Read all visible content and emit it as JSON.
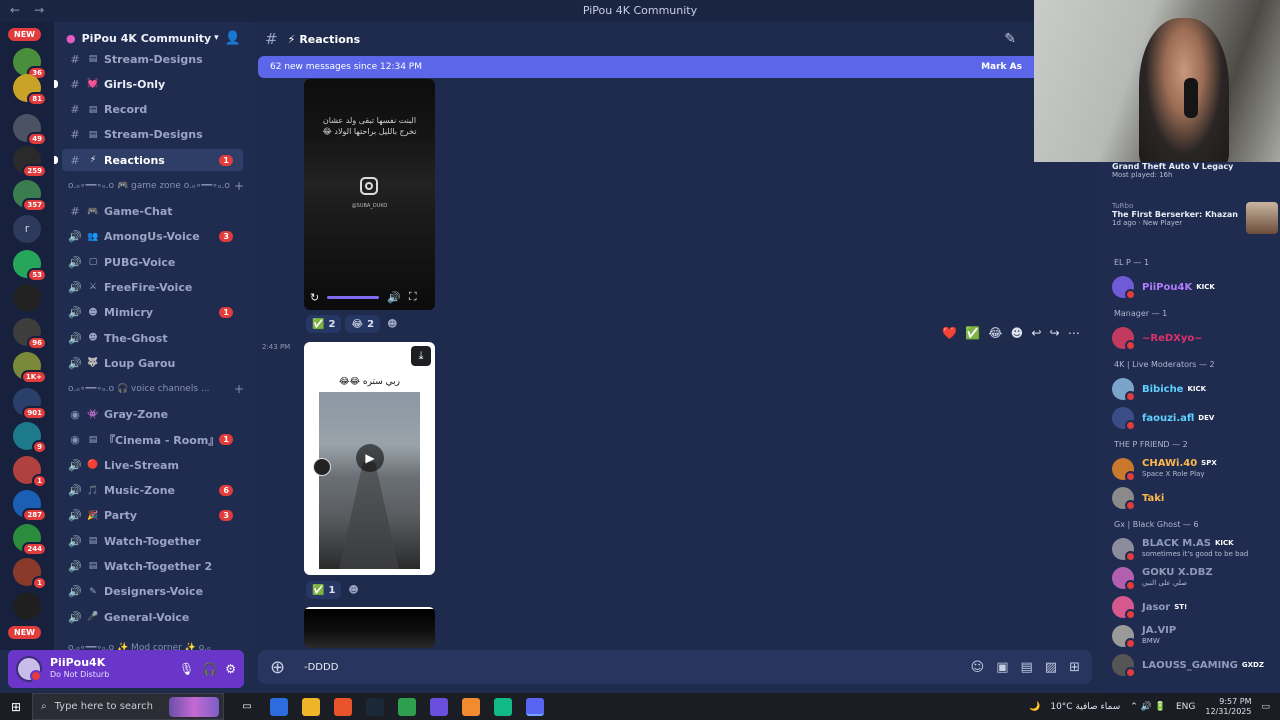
{
  "window": {
    "title": "PiPou 4K Community",
    "back": "←",
    "forward": "→"
  },
  "rail": {
    "new_top": "NEW",
    "new_bottom": "NEW",
    "servers": [
      {
        "badge": "36",
        "color": "#4a8d3a"
      },
      {
        "badge": "81",
        "color": "#c9a227"
      },
      {
        "badge": "49",
        "color": "#4b5263"
      },
      {
        "badge": "259",
        "color": "#2a2a2a"
      },
      {
        "badge": "357",
        "color": "#3b7d4f"
      },
      {
        "badge": "",
        "letter": "r",
        "color": "#2e3a5c"
      },
      {
        "badge": "53",
        "color": "#26a65b"
      },
      {
        "badge": "",
        "color": "#222222"
      },
      {
        "badge": "96",
        "color": "#3d3d3d"
      },
      {
        "badge": "1K+",
        "color": "#7a8a3a"
      },
      {
        "badge": "901",
        "color": "#2a3f6a"
      },
      {
        "badge": "9",
        "color": "#1c7a8a"
      },
      {
        "badge": "1",
        "color": "#b0413e"
      },
      {
        "badge": "287",
        "color": "#1a5fb4"
      },
      {
        "badge": "244",
        "color": "#2b8c3e"
      },
      {
        "badge": "1",
        "color": "#8a3a2a"
      },
      {
        "badge": "",
        "color": "#1f1f1f"
      }
    ]
  },
  "sidebar": {
    "guild_name": "PiPou 4K Community",
    "channels": [
      {
        "kind": "text",
        "icon": "#",
        "emoji": "▤",
        "label": "Stream-Designs",
        "state": "muted"
      },
      {
        "kind": "text",
        "icon": "#",
        "emoji": "💓",
        "label": "Girls-Only",
        "state": "bright",
        "unread": true
      },
      {
        "kind": "text",
        "icon": "#",
        "emoji": "▤",
        "label": "Record",
        "state": "muted"
      },
      {
        "kind": "text",
        "icon": "#",
        "emoji": "▤",
        "label": "Stream-Designs",
        "state": "muted"
      },
      {
        "kind": "text",
        "icon": "#",
        "emoji": "⚡",
        "label": "Reactions",
        "state": "selected",
        "count": "1",
        "unread": true
      },
      {
        "kind": "category",
        "label": "o.ₒ∘━━∘ₒ.o 🎮 game zone o.ₒ∘━━∘ₒ.o"
      },
      {
        "kind": "text",
        "icon": "#",
        "emoji": "🎮",
        "label": "Game-Chat",
        "state": "muted"
      },
      {
        "kind": "voice",
        "icon": "🔊",
        "emoji": "👥",
        "label": "AmongUs-Voice",
        "state": "muted",
        "count": "3"
      },
      {
        "kind": "voice",
        "icon": "🔊",
        "emoji": "▢",
        "label": "PUBG-Voice",
        "state": "muted"
      },
      {
        "kind": "voice",
        "icon": "🔊",
        "emoji": "⚔",
        "label": "FreeFire-Voice",
        "state": "muted"
      },
      {
        "kind": "voice",
        "icon": "🔊",
        "emoji": "☻",
        "label": "Mimicry",
        "state": "muted",
        "count": "1"
      },
      {
        "kind": "voice",
        "icon": "🔊",
        "emoji": "☻",
        "label": "The-Ghost",
        "state": "muted"
      },
      {
        "kind": "voice",
        "icon": "🔊",
        "emoji": "🐺",
        "label": "Loup Garou",
        "state": "muted"
      },
      {
        "kind": "category",
        "label": "o.ₒ∘━━∘ₒ.o 🎧 voice channels ..."
      },
      {
        "kind": "stage",
        "icon": "◉",
        "emoji": "👾",
        "label": "Gray-Zone",
        "state": "muted"
      },
      {
        "kind": "stage",
        "icon": "◉",
        "emoji": "▤",
        "label": "『Cinema - Room』",
        "state": "muted",
        "count": "1"
      },
      {
        "kind": "voice",
        "icon": "🔊",
        "emoji": "🔴",
        "label": "Live-Stream",
        "state": "muted"
      },
      {
        "kind": "voice",
        "icon": "🔊",
        "emoji": "🎵",
        "label": "Music-Zone",
        "state": "muted",
        "count": "6"
      },
      {
        "kind": "voice",
        "icon": "🔊",
        "emoji": "🎉",
        "label": "Party",
        "state": "muted",
        "count": "3"
      },
      {
        "kind": "voice",
        "icon": "🔊",
        "emoji": "▤",
        "label": "Watch-Together",
        "state": "muted"
      },
      {
        "kind": "voice",
        "icon": "🔊",
        "emoji": "▤",
        "label": "Watch-Together 2",
        "state": "muted"
      },
      {
        "kind": "voice",
        "icon": "🔊",
        "emoji": "✎",
        "label": "Designers-Voice",
        "state": "muted"
      },
      {
        "kind": "voice",
        "icon": "🔊",
        "emoji": "🎤",
        "label": "General-Voice",
        "state": "muted"
      }
    ],
    "bottom_category": "o.ₒ∘━━∘ₒ.o ✨ Mod corner ✨ o.ₒ"
  },
  "user": {
    "name": "PiiPou4K",
    "status": "Do Not Disturb"
  },
  "chat": {
    "channel_name": "Reactions",
    "channel_emoji": "⚡",
    "new_messages": "62 new messages since 12:34 PM",
    "mark_as_read": "Mark As",
    "msg1": {
      "caption": "البنت نفسها تبقى ولد عشان تخرج بالليل براحتها الولاد 😂",
      "handle": "@SUBA_DUKO",
      "reactions": [
        {
          "emoji": "✅",
          "count": "2"
        },
        {
          "emoji": "😂",
          "count": "2"
        }
      ]
    },
    "msg2": {
      "time": "2:43 PM",
      "caption": "ربي ستره 😂😂",
      "reactions": [
        {
          "emoji": "✅",
          "count": "1"
        }
      ]
    },
    "hover_actions": [
      "❤️",
      "✅",
      "😂",
      "☻",
      "↩",
      "↪",
      "⋯"
    ],
    "composer_value": "-DDDD"
  },
  "members": {
    "activities": [
      {
        "title": "Grand Theft Auto V Legacy",
        "sub": "Most played: 16h"
      },
      {
        "kicker": "TuRbo",
        "title": "The First Berserker: Khazan",
        "sub": "1d ago · New Player"
      }
    ],
    "groups": [
      {
        "heading": "EL P — 1",
        "members": [
          {
            "name": "PiiPou4K",
            "tag": "KICK",
            "color": "#b07cff"
          }
        ]
      },
      {
        "heading": "Manager — 1",
        "members": [
          {
            "name": "~ReDXyo~",
            "tag": "",
            "color": "#e0306b"
          }
        ]
      },
      {
        "heading": "4K | Live Moderators — 2",
        "members": [
          {
            "name": "Bibiche",
            "tag": "KICK",
            "color": "#5fd1ff"
          },
          {
            "name": "faouzi.afl",
            "tag": "DEV",
            "color": "#5fd1ff"
          }
        ]
      },
      {
        "heading": "THE P FRIEND — 2",
        "members": [
          {
            "name": "CHAWi.40",
            "tag": "SPX",
            "sub": "Space X Role Play",
            "color": "#ffb84d"
          },
          {
            "name": "Taki",
            "tag": "",
            "color": "#ffb84d"
          }
        ]
      },
      {
        "heading": "Gx | Black Ghost — 6",
        "members": [
          {
            "name": "BLACK M.AS",
            "tag": "KICK",
            "sub": "sometimes it's good to be bad",
            "color": "#8f9bb8"
          },
          {
            "name": "GOKU X.DBZ",
            "tag": "",
            "sub": "صلي على النبي",
            "color": "#8f9bb8"
          },
          {
            "name": "Jasor",
            "tag": "ST!",
            "color": "#8f9bb8"
          },
          {
            "name": "JA.VIP",
            "tag": "",
            "sub": "BMW",
            "color": "#8f9bb8"
          },
          {
            "name": "LAOUSS_GAMING",
            "tag": "GXDZ",
            "color": "#8f9bb8"
          }
        ]
      }
    ]
  },
  "taskbar": {
    "search_placeholder": "Type here to search",
    "weather": "10°C سماء صافية",
    "lang": "ENG",
    "time": "9:57 PM",
    "date": "12/31/2025"
  },
  "colors": {
    "accent": "#5b67e8",
    "user_panel": "#6a36c9",
    "badge": "#e23c3c"
  }
}
